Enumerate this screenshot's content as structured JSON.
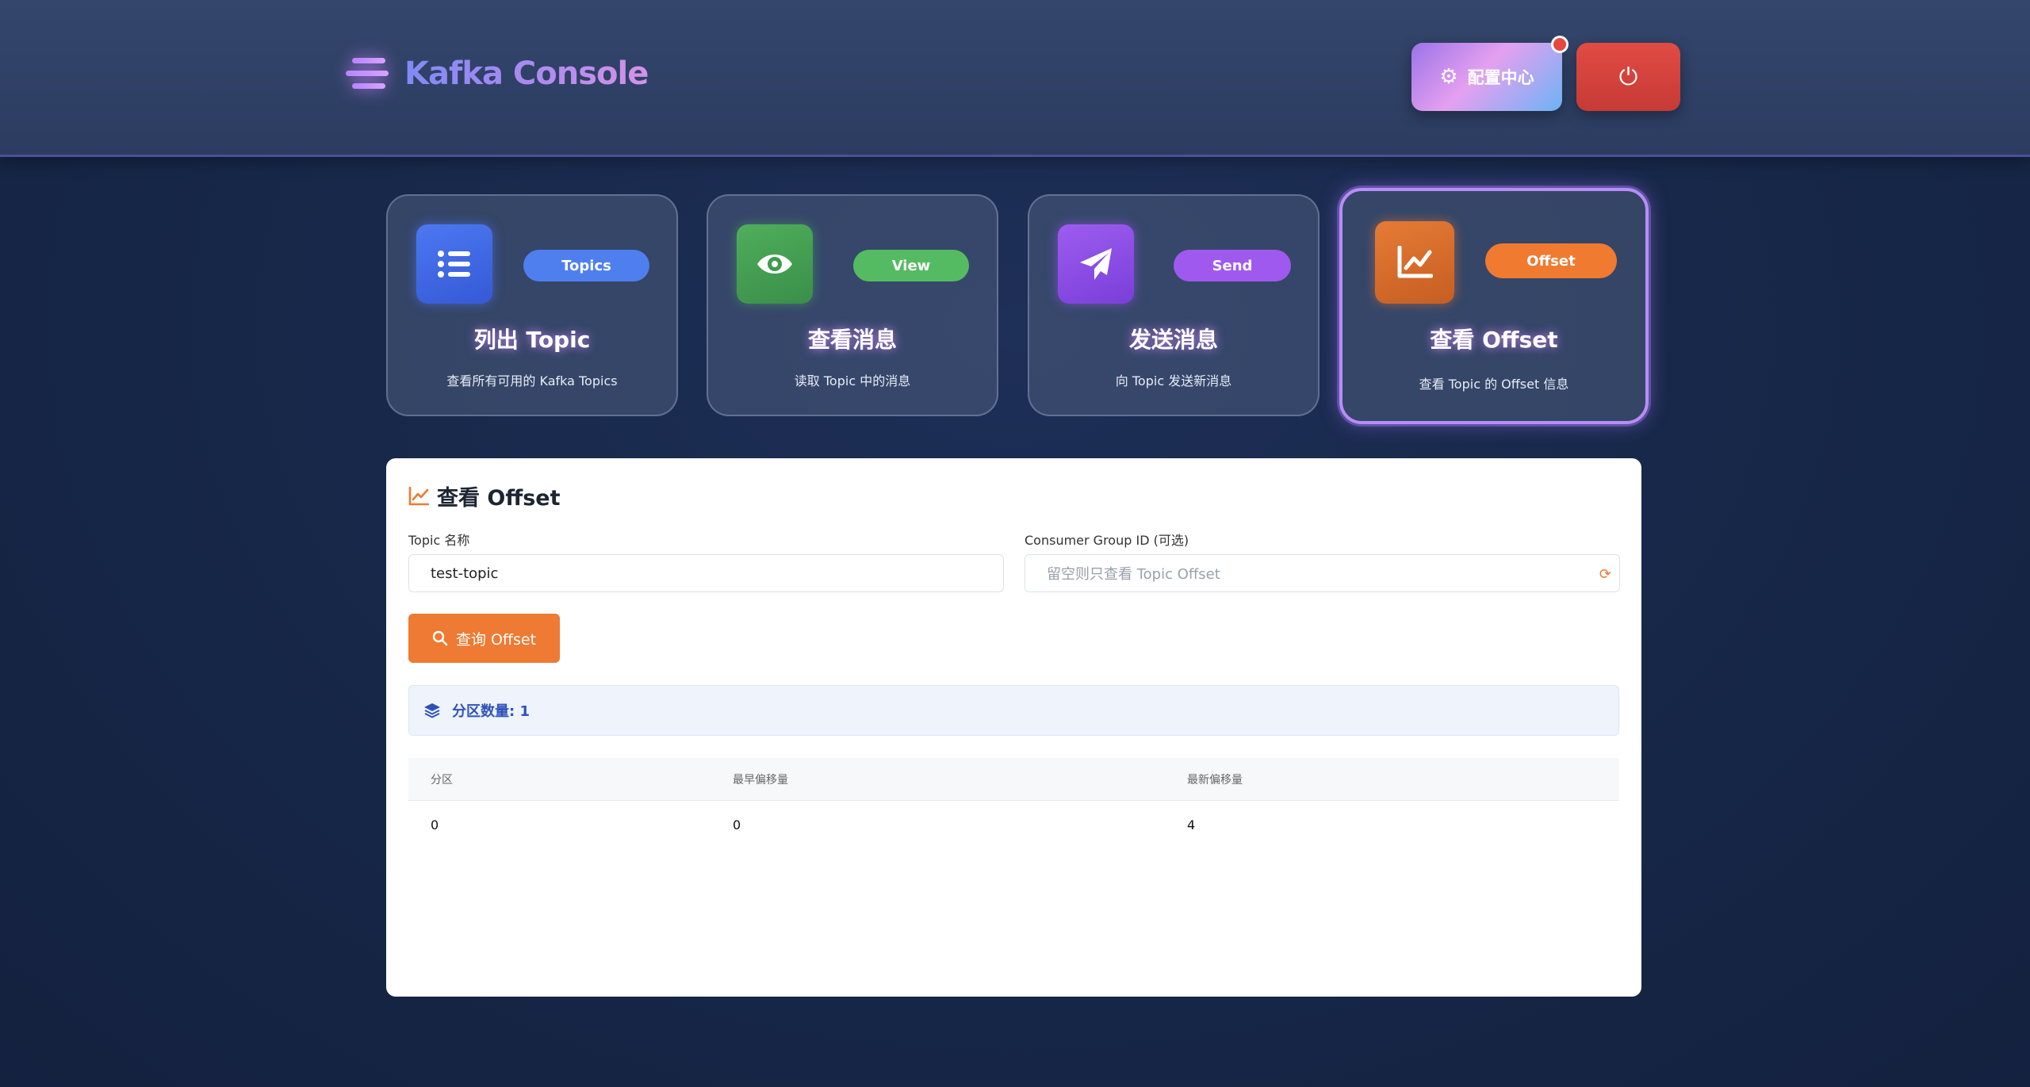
{
  "header": {
    "brand_title": "Kafka Console",
    "config_label": "配置中心",
    "icons": [
      "menu-icon",
      "gear-icon",
      "power-icon"
    ]
  },
  "cards": [
    {
      "pill": "Topics",
      "title": "列出 Topic",
      "desc": "查看所有可用的 Kafka Topics",
      "icon": "list-icon",
      "color": "#4a74ef"
    },
    {
      "pill": "View",
      "title": "查看消息",
      "desc": "读取 Topic 中的消息",
      "icon": "eye-icon",
      "color": "#4fb360"
    },
    {
      "pill": "Send",
      "title": "发送消息",
      "desc": "向 Topic 发送新消息",
      "icon": "paper-plane-icon",
      "color": "#9a5ce8"
    },
    {
      "pill": "Offset",
      "title": "查看 Offset",
      "desc": "查看 Topic 的 Offset 信息",
      "icon": "chart-line-icon",
      "color": "#ea7832",
      "active": true
    }
  ],
  "panel": {
    "title": "查看 Offset",
    "topic_label": "Topic 名称",
    "topic_value": "test-topic",
    "group_label": "Consumer Group ID (可选)",
    "group_placeholder": "留空则只查看 Topic Offset",
    "query_label": "查询 Offset",
    "partition_info": "分区数量: 1",
    "table": {
      "headers": [
        "分区",
        "最早偏移量",
        "最新偏移量"
      ],
      "rows": [
        [
          "0",
          "0",
          "4"
        ]
      ]
    }
  }
}
